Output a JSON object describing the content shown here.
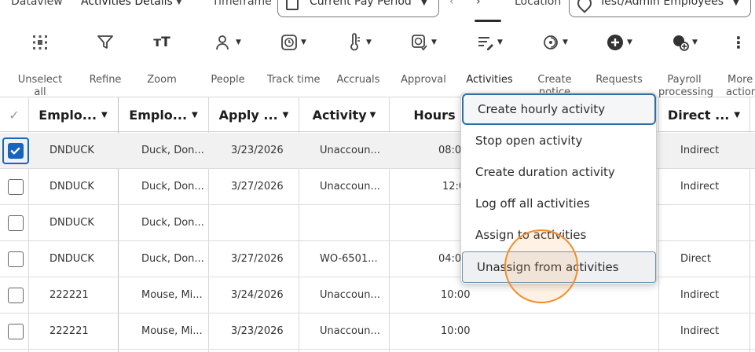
{
  "topbar": {
    "dataview_label": "Dataview",
    "dataview_value": "Activities Details",
    "timeframe_label": "Timeframe",
    "timeframe_value": "Current Pay Period",
    "location_label": "Location",
    "location_value": "Test/Admin Employees"
  },
  "toolbar": {
    "items": [
      {
        "label": "Unselect",
        "label2": "all",
        "icon": "unselect-all-icon"
      },
      {
        "label": "Refine",
        "icon": "filter-icon"
      },
      {
        "label": "Zoom",
        "icon": "zoom-text-icon"
      },
      {
        "label": "People",
        "icon": "people-icon"
      },
      {
        "label": "Track time",
        "icon": "track-time-icon"
      },
      {
        "label": "Accruals",
        "icon": "thermometer-icon"
      },
      {
        "label": "Approval",
        "icon": "approval-icon"
      },
      {
        "label": "Activities",
        "icon": "activities-icon"
      },
      {
        "label": "Create",
        "label2": "notice",
        "icon": "create-notice-icon"
      },
      {
        "label": "Requests",
        "icon": "requests-plus-icon"
      },
      {
        "label": "Payroll",
        "label2": "processing",
        "icon": "payroll-icon"
      },
      {
        "label": "More",
        "label2": "actions",
        "icon": "more-vertical-icon"
      }
    ]
  },
  "table": {
    "columns": [
      "Emplo...",
      "Emplo...",
      "Apply ...",
      "Activity",
      "Hours",
      "Direct ..."
    ],
    "rows": [
      {
        "id": "DNDUCK",
        "name": "Duck, Don...",
        "date": "3/23/2026",
        "activity": "Unaccoun...",
        "hours": "08:0",
        "direct": "Indirect",
        "checked": true
      },
      {
        "id": "DNDUCK",
        "name": "Duck, Don...",
        "date": "3/27/2026",
        "activity": "Unaccoun...",
        "hours": "12:0",
        "direct": "Indirect",
        "checked": false
      },
      {
        "id": "DNDUCK",
        "name": "Duck, Don...",
        "date": "",
        "activity": "",
        "hours": "",
        "direct": "",
        "checked": false
      },
      {
        "id": "DNDUCK",
        "name": "Duck, Don...",
        "date": "3/27/2026",
        "activity": "WO-6501...",
        "hours": "04:0",
        "direct": "Direct",
        "checked": false
      },
      {
        "id": "222221",
        "name": "Mouse, Mi...",
        "date": "3/24/2026",
        "activity": "Unaccoun...",
        "hours": "10:00",
        "direct": "Indirect",
        "checked": false
      },
      {
        "id": "222221",
        "name": "Mouse, Mi...",
        "date": "3/23/2026",
        "activity": "Unaccoun...",
        "hours": "10:00",
        "direct": "Indirect",
        "checked": false
      }
    ]
  },
  "menu": {
    "items": [
      "Create hourly activity",
      "Stop open activity",
      "Create duration activity",
      "Log off all activities",
      "Assign to activities",
      "Unassign from activities"
    ]
  },
  "colors": {
    "accent": "#1565c0",
    "focus_border": "#2f6fa3",
    "click_ring": "#f28c28"
  }
}
